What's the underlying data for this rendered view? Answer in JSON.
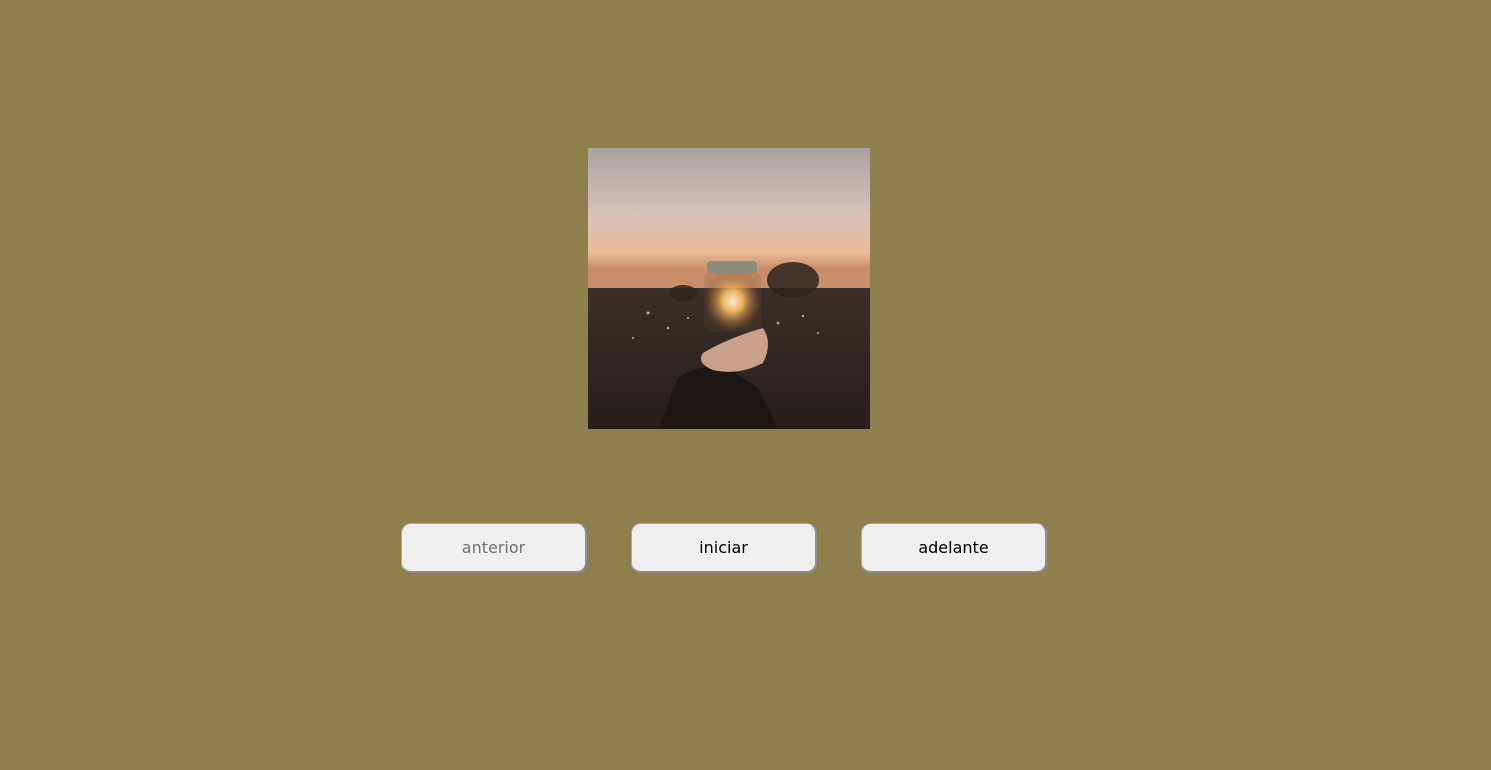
{
  "slideshow": {
    "image": {
      "icon": "jar-with-sunset-photo"
    },
    "buttons": {
      "previous_label": "anterior",
      "start_label": "iniciar",
      "next_label": "adelante"
    },
    "previous_disabled": true
  },
  "colors": {
    "background": "#8f7f4c",
    "button_bg": "#efefef",
    "button_text": "#000000",
    "button_disabled_text": "#6f6f6f"
  }
}
